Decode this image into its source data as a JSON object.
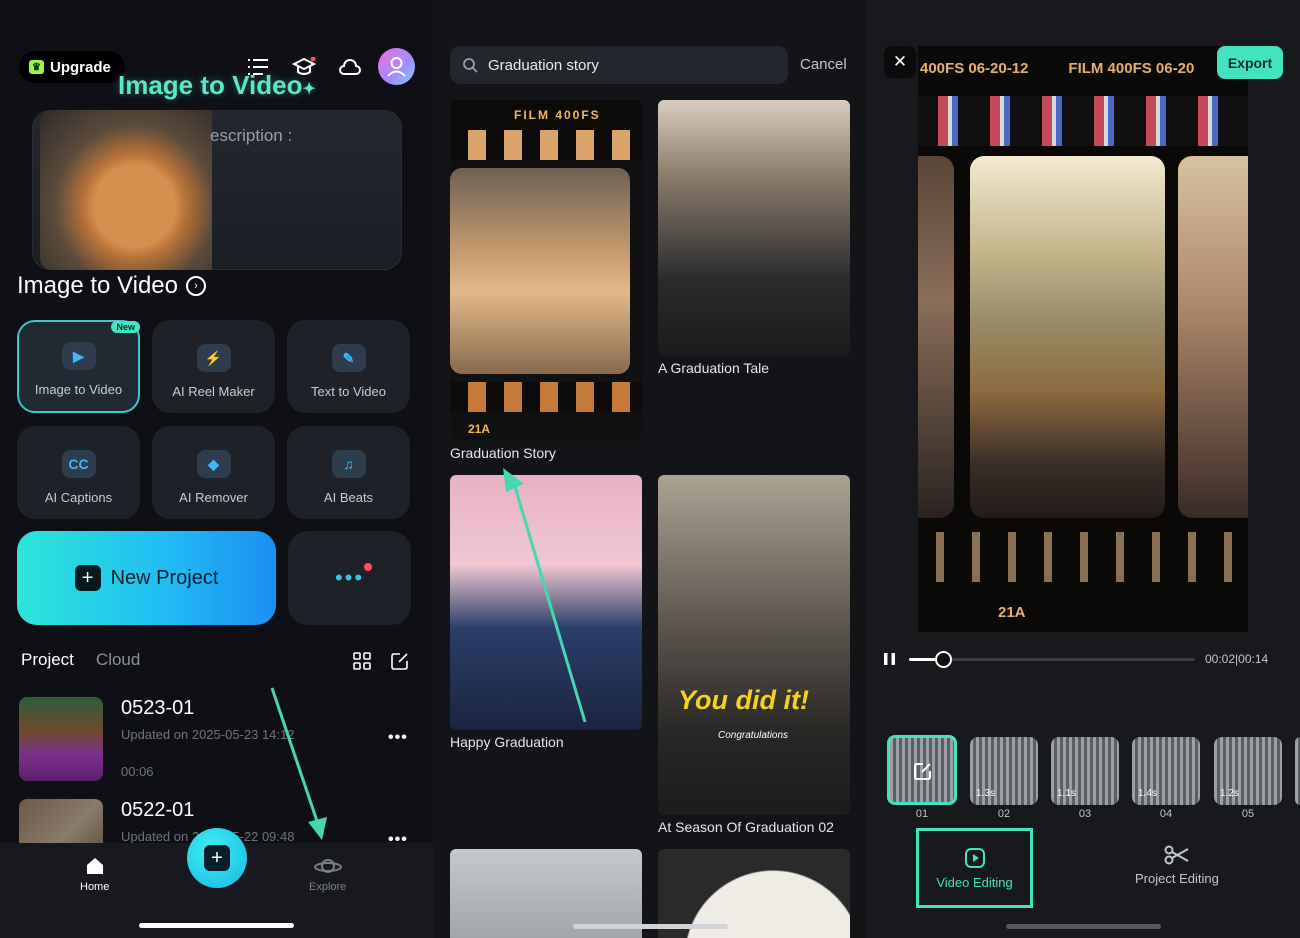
{
  "home": {
    "upgrade_label": "Upgrade",
    "hero_title": "Image to Video",
    "hero_description": "escription :",
    "section_title": "Image to Video",
    "tools": [
      {
        "label": "Image to Video",
        "icon": "image-to-video-icon",
        "badge": "New"
      },
      {
        "label": "AI Reel Maker",
        "icon": "ai-reel-maker-icon"
      },
      {
        "label": "Text to Video",
        "icon": "text-to-video-icon"
      },
      {
        "label": "AI Captions",
        "icon": "cc-icon",
        "glyph": "CC"
      },
      {
        "label": "AI Remover",
        "icon": "eraser-icon"
      },
      {
        "label": "AI Beats",
        "icon": "beats-icon"
      }
    ],
    "new_project_label": "New Project",
    "tabs": [
      "Project",
      "Cloud"
    ],
    "projects": [
      {
        "name": "0523-01",
        "updated": "Updated on 2025-05-23 14:12",
        "duration": "00:06"
      },
      {
        "name": "0522-01",
        "updated": "Updated on 2025-05-22 09:48",
        "duration": ""
      }
    ],
    "nav": {
      "home_label": "Home",
      "explore_label": "Explore"
    }
  },
  "search": {
    "query": "Graduation story",
    "cancel_label": "Cancel",
    "results": [
      {
        "label": "Graduation Story"
      },
      {
        "label": "A Graduation Tale"
      },
      {
        "label": "Happy Graduation"
      },
      {
        "label": "At Season Of Graduation 02"
      }
    ],
    "film_text_top": "FILM 400FS",
    "film_text_bottom": "21A",
    "overlay_title": "You did it!",
    "overlay_subtitle": "Congratulations"
  },
  "editor": {
    "export_label": "Export",
    "film_text_top": "400FS 06-20-12",
    "film_text_top2": "FILM 400FS 06-20",
    "film_text_bottom": "21A",
    "time_display": "00:02|00:14",
    "progress": 0.12,
    "clips": [
      {
        "num": "01",
        "duration": ""
      },
      {
        "num": "02",
        "duration": "1.3s"
      },
      {
        "num": "03",
        "duration": "1.1s"
      },
      {
        "num": "04",
        "duration": "1.4s"
      },
      {
        "num": "05",
        "duration": "1.2s"
      }
    ],
    "tabs": {
      "video_editing": "Video Editing",
      "project_editing": "Project Editing"
    },
    "accent_color": "#43e3bf"
  }
}
